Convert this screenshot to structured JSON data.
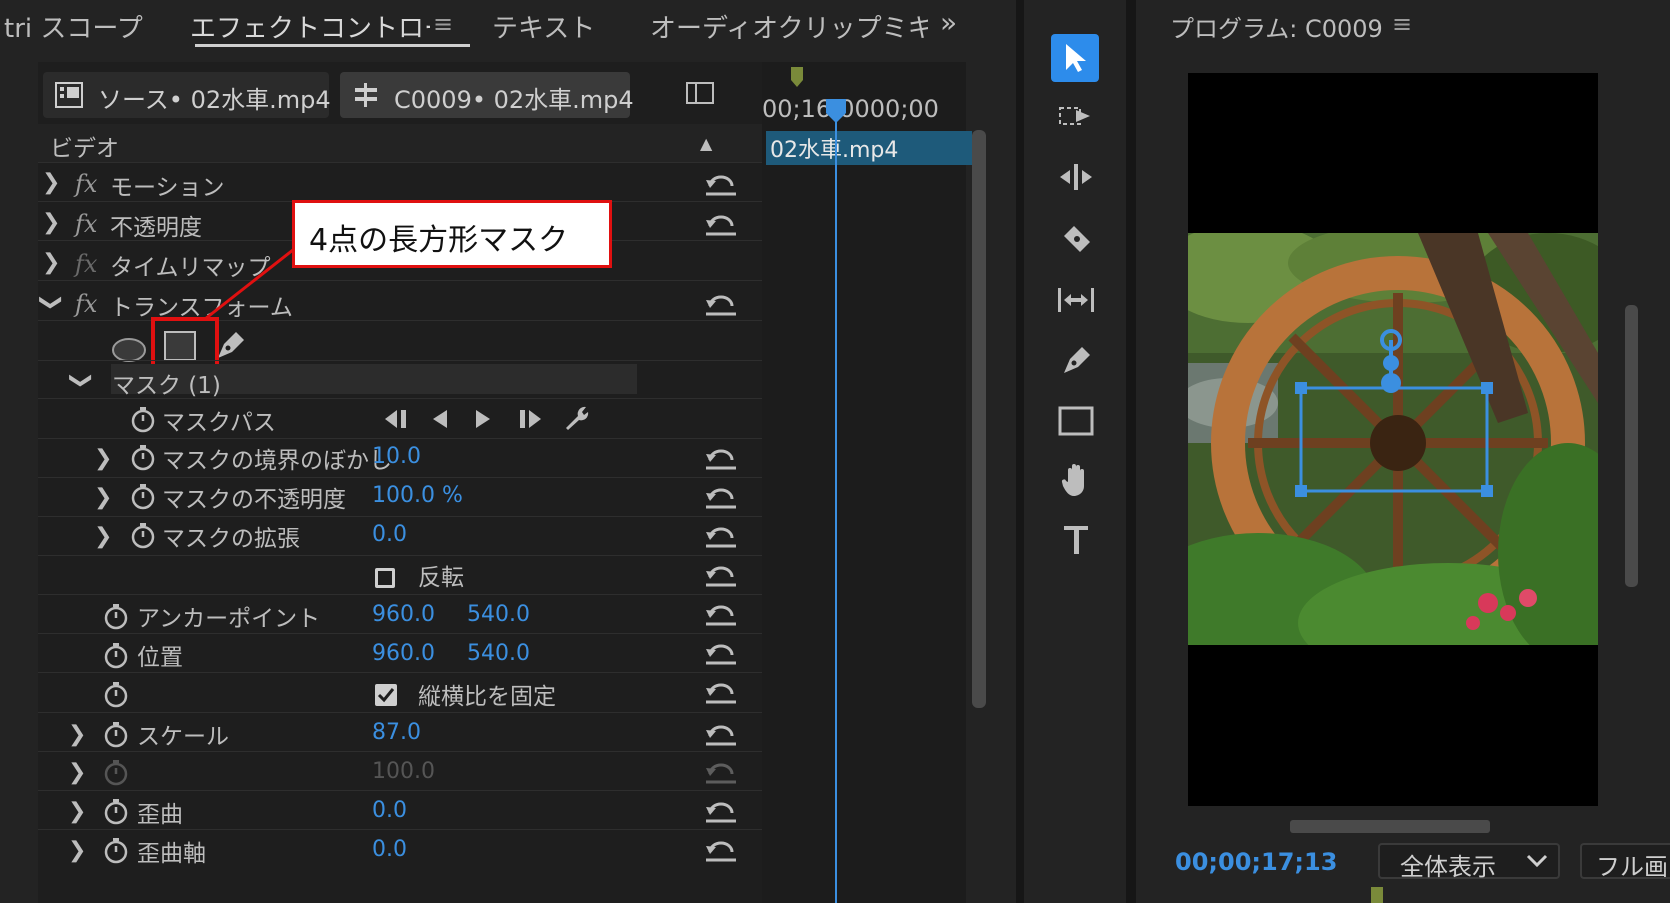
{
  "top_tabs": {
    "scopes": "tri スコープ",
    "effect_controls": "エフェクトコントロール",
    "text": "テキスト",
    "audio_mixer": "オーディオクリップミキサ-",
    "overflow": "»"
  },
  "clip_tabs": {
    "source": "ソース• 02水車.mp4",
    "sequence": "C0009• 02水車.mp4"
  },
  "timeline": {
    "timecode_ruler": "00;16;0000;00",
    "clip_name": "02水車.mp4"
  },
  "effects": {
    "video_header": "ビデオ",
    "motion": "モーション",
    "opacity": "不透明度",
    "time_remap": "タイムリマップ",
    "transform": "トランスフォーム",
    "fx_label": "fx",
    "mask_name": "マスク (1)",
    "mask_path": "マスクパス",
    "mask_feather": {
      "label": "マスクの境界のぼかし",
      "value": "10.0"
    },
    "mask_opacity": {
      "label": "マスクの不透明度",
      "value": "100.0 %"
    },
    "mask_expansion": {
      "label": "マスクの拡張",
      "value": "0.0"
    },
    "inverted": {
      "label": "反転",
      "checked": false
    },
    "anchor_point": {
      "label": "アンカーポイント",
      "x": "960.0",
      "y": "540.0"
    },
    "position": {
      "label": "位置",
      "x": "960.0",
      "y": "540.0"
    },
    "uniform_scale": {
      "label": "縦横比を固定",
      "checked": true
    },
    "scale": {
      "label": "スケール",
      "value": "87.0"
    },
    "scale_width": {
      "value": "100.0"
    },
    "skew": {
      "label": "歪曲",
      "value": "0.0"
    },
    "skew_axis": {
      "label": "歪曲軸",
      "value": "0.0"
    }
  },
  "callout": {
    "text": "4点の長方形マスク"
  },
  "program_monitor": {
    "title": "プログラム: C0009",
    "timecode": "00;00;17;13",
    "zoom": "全体表示",
    "resolution": "フル画"
  },
  "colors": {
    "accent_blue": "#2d8ceb",
    "value_blue": "#3b8fe0",
    "highlight_red": "#e01010"
  }
}
